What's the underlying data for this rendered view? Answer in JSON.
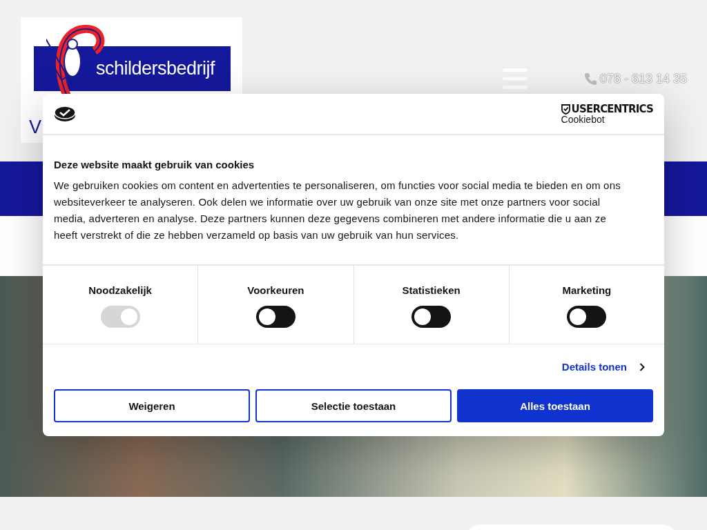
{
  "header": {
    "logo_text": "schildersbedrijf",
    "logo_text_2": "V",
    "phone": "078 - 613 14 35"
  },
  "consent": {
    "brand": "USERCENTRICS",
    "brand_sub": "Cookiebot",
    "title": "Deze website maakt gebruik van cookies",
    "body": "We gebruiken cookies om content en advertenties te personaliseren, om functies voor social media te bieden en om ons websiteverkeer te analyseren. Ook delen we informatie over uw gebruik van onze site met onze partners voor social media, adverteren en analyse. Deze partners kunnen deze gegevens combineren met andere informatie die u aan ze heeft verstrekt of die ze hebben verzameld op basis van uw gebruik van hun services.",
    "categories": [
      {
        "label": "Noodzakelijk",
        "on": true,
        "disabled": true
      },
      {
        "label": "Voorkeuren",
        "on": false,
        "disabled": false
      },
      {
        "label": "Statistieken",
        "on": false,
        "disabled": false
      },
      {
        "label": "Marketing",
        "on": false,
        "disabled": false
      }
    ],
    "details_link": "Details tonen",
    "buttons": [
      {
        "label": "Weigeren",
        "kind": "outline"
      },
      {
        "label": "Selectie toestaan",
        "kind": "outline"
      },
      {
        "label": "Alles toestaan",
        "kind": "primary"
      }
    ]
  }
}
